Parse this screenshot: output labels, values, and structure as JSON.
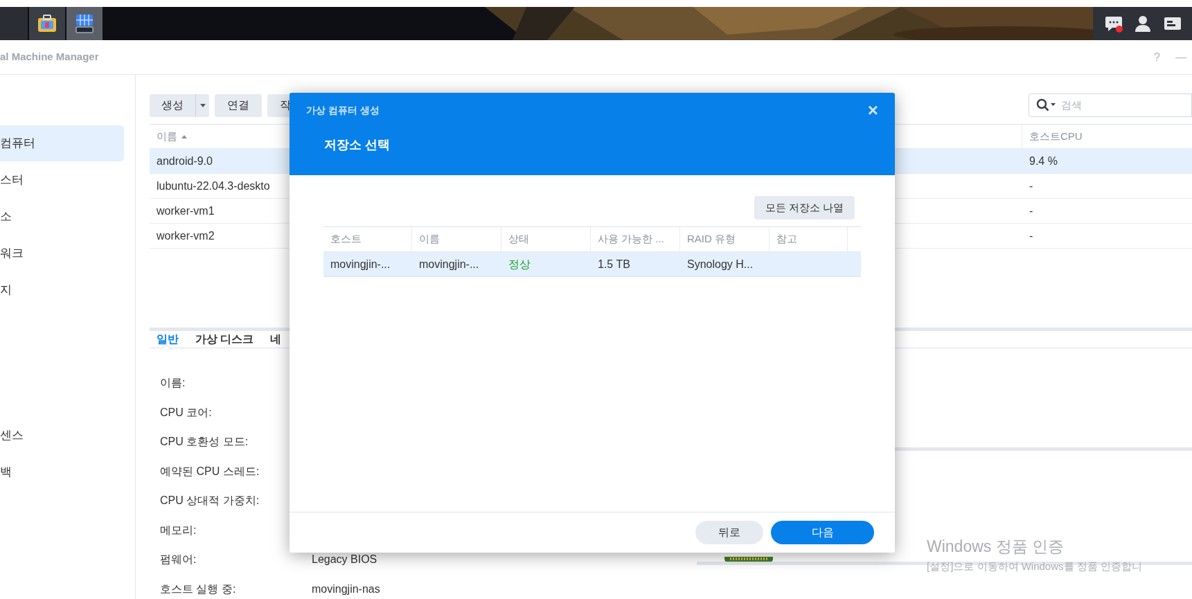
{
  "taskbar": {
    "apps": [
      {
        "selected": false
      },
      {
        "selected": true
      }
    ],
    "notification": true
  },
  "window": {
    "title": "al Machine Manager",
    "help": "?",
    "minimize": "—"
  },
  "sidebar": {
    "groups": [
      [
        {
          "label": "컴퓨터",
          "selected": true
        },
        {
          "label": "스터",
          "selected": false
        },
        {
          "label": "소",
          "selected": false
        },
        {
          "label": "워크",
          "selected": false
        },
        {
          "label": "지",
          "selected": false
        }
      ],
      [
        {
          "label": "센스",
          "selected": false
        },
        {
          "label": "백",
          "selected": false
        }
      ]
    ]
  },
  "toolbar": {
    "buttons": [
      {
        "label": "생성",
        "kind": "split"
      },
      {
        "label": "연결",
        "kind": "plain"
      },
      {
        "label": "작",
        "kind": "plain"
      }
    ]
  },
  "search": {
    "placeholder": "검색"
  },
  "vm_table": {
    "columns": [
      {
        "label": "이름",
        "sorted": true
      },
      {
        "label": "호스트CPU",
        "sorted": false
      }
    ],
    "rows": [
      {
        "name": "android-9.0",
        "host_cpu": "9.4 %",
        "selected": true
      },
      {
        "name": "lubuntu-22.04.3-deskto",
        "host_cpu": "-",
        "selected": false
      },
      {
        "name": "worker-vm1",
        "host_cpu": "-",
        "selected": false
      },
      {
        "name": "worker-vm2",
        "host_cpu": "-",
        "selected": false
      }
    ]
  },
  "detail_tabs": [
    {
      "label": "일반",
      "selected": true
    },
    {
      "label": "가상 디스크",
      "selected": false
    },
    {
      "label": "네",
      "selected": false
    }
  ],
  "details": [
    {
      "label": "이름:"
    },
    {
      "label": "CPU 코어:"
    },
    {
      "label": "CPU 호환성 모드:"
    },
    {
      "label": "예약된 CPU 스레드:"
    },
    {
      "label": "CPU 상대적 가중치:"
    },
    {
      "label": "메모리:"
    },
    {
      "label": "펌웨어:",
      "value": "Legacy BIOS"
    },
    {
      "label": "호스트 실행 중:",
      "value": "movingjin-nas"
    }
  ],
  "dialog": {
    "window_title": "가상 컴퓨터 생성",
    "step_title": "저장소 선택",
    "close": "×",
    "list_all_button": "모든 저장소 나열",
    "columns": [
      "호스트",
      "이름",
      "상태",
      "사용 가능한 ...",
      "RAID 유형",
      "참고"
    ],
    "rows": [
      {
        "cells": [
          "movingjin-...",
          "movingjin-...",
          "정상",
          "1.5 TB",
          "Synology H...",
          ""
        ],
        "healthy": true,
        "selected": true
      }
    ],
    "buttons": [
      {
        "label": "뒤로",
        "kind": "secondary"
      },
      {
        "label": "다음",
        "kind": "primary"
      }
    ]
  },
  "activation_notice": {
    "title": "Windows 정품 인증",
    "message": "[설정]으로 이동하여 Windows를 정품 인증합니"
  }
}
